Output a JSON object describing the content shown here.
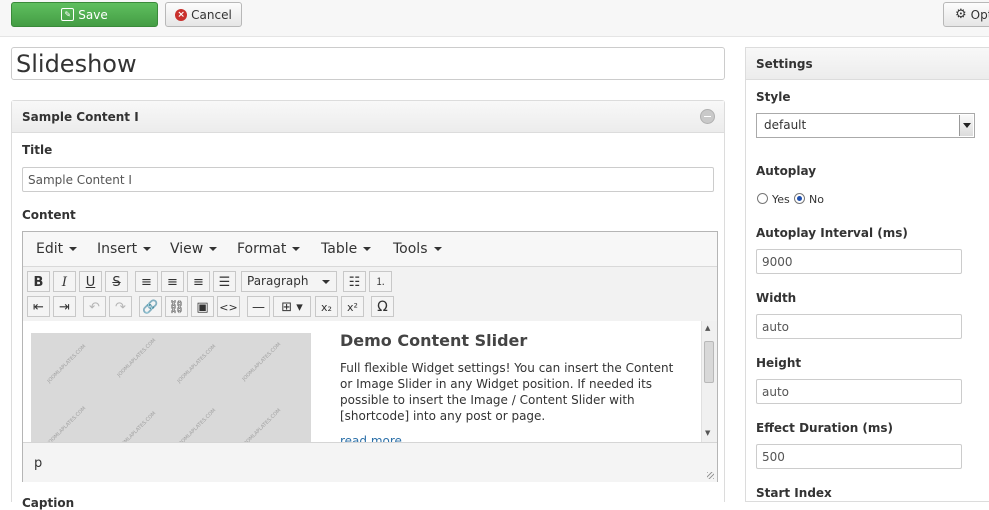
{
  "toolbar": {
    "save_label": "Save",
    "cancel_label": "Cancel",
    "options_label": "Opt"
  },
  "widget_title_value": "Slideshow",
  "panel": {
    "title": "Sample Content I",
    "title_label": "Title",
    "title_value": "Sample Content I",
    "content_label": "Content",
    "next_label": "Caption"
  },
  "editor": {
    "menu": [
      "Edit",
      "Insert",
      "View",
      "Format",
      "Table",
      "Tools"
    ],
    "format_select": "Paragraph",
    "buttons_row1": [
      "bold",
      "italic",
      "underline",
      "strikethrough",
      "align-left",
      "align-center",
      "align-right",
      "justify",
      "bullet-list",
      "numbered-list"
    ],
    "buttons_row2": [
      "outdent",
      "indent",
      "undo",
      "redo",
      "link",
      "unlink",
      "image",
      "code",
      "horizontal-rule",
      "table",
      "subscript",
      "superscript",
      "special-char"
    ],
    "content": {
      "heading": "Demo Content Slider",
      "body": "Full flexible Widget settings! You can insert the Content or Image Slider in any Widget position. If needed its possible to insert the Image / Content Slider with [shortcode] into any post or page.",
      "link": "read more",
      "watermark": "JOOMLAPLATES.COM"
    },
    "status_path": "p"
  },
  "settings": {
    "title": "Settings",
    "style_label": "Style",
    "style_value": "default",
    "autoplay_label": "Autoplay",
    "autoplay_yes": "Yes",
    "autoplay_no": "No",
    "autoplay_selected": "No",
    "interval_label": "Autoplay Interval (ms)",
    "interval_value": "9000",
    "width_label": "Width",
    "width_value": "auto",
    "height_label": "Height",
    "height_value": "auto",
    "duration_label": "Effect Duration (ms)",
    "duration_value": "500",
    "start_index_label": "Start Index"
  }
}
